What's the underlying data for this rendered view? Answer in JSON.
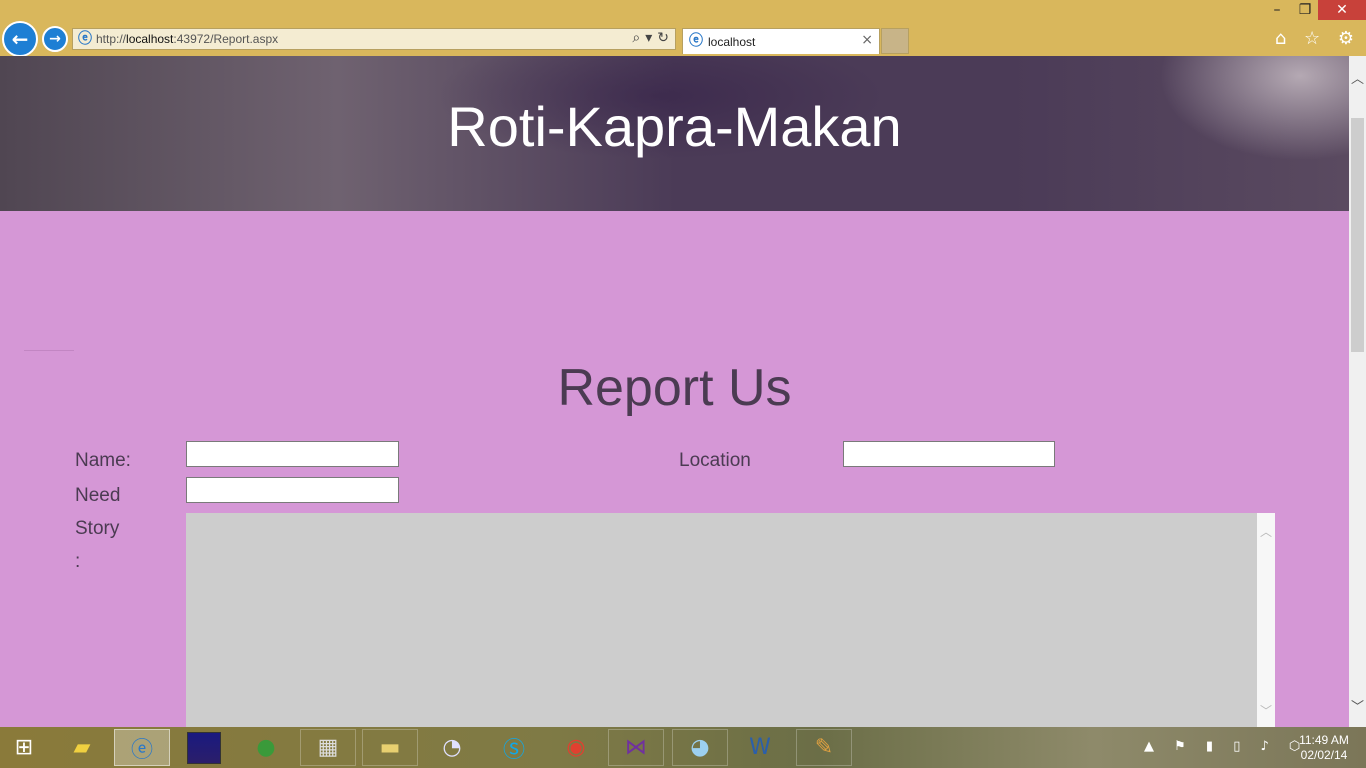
{
  "browser": {
    "url_prefix": "http://",
    "url_host": "localhost",
    "url_rest": ":43972/Report.aspx",
    "tab_title": "localhost",
    "back_icon": "←",
    "forward_icon": "→",
    "close_tab": "×",
    "window_controls": [
      "–",
      "❐",
      "✕"
    ],
    "toolbar_icons": "⌂ ☆ ⚙"
  },
  "page": {
    "site_title": "Roti-Kapra-Makan",
    "heading": "Report Us",
    "labels": {
      "name": "Name:",
      "location": "Location",
      "need": "Need",
      "story": "Story",
      "story_colon": ":"
    },
    "fields": {
      "name_value": "",
      "location_value": "",
      "need_value": "",
      "story_value": ""
    }
  },
  "taskbar": {
    "start_icon": "windows-logo",
    "apps": [
      "explorer-files",
      "internet-explorer",
      "media-player",
      "download-manager",
      "firewall",
      "file-explorer",
      "torrent",
      "skype",
      "chrome",
      "visual-studio",
      "cat-app",
      "word",
      "paint"
    ],
    "tray_icons": "▲ ⚑ ▮ ▯ ♪ ⬡",
    "time": "11:49 AM",
    "date": "02/02/14"
  },
  "colors": {
    "page_bg": "#d597d6",
    "text_dark": "#4b3b52",
    "chrome_bg": "#d9b75c"
  }
}
